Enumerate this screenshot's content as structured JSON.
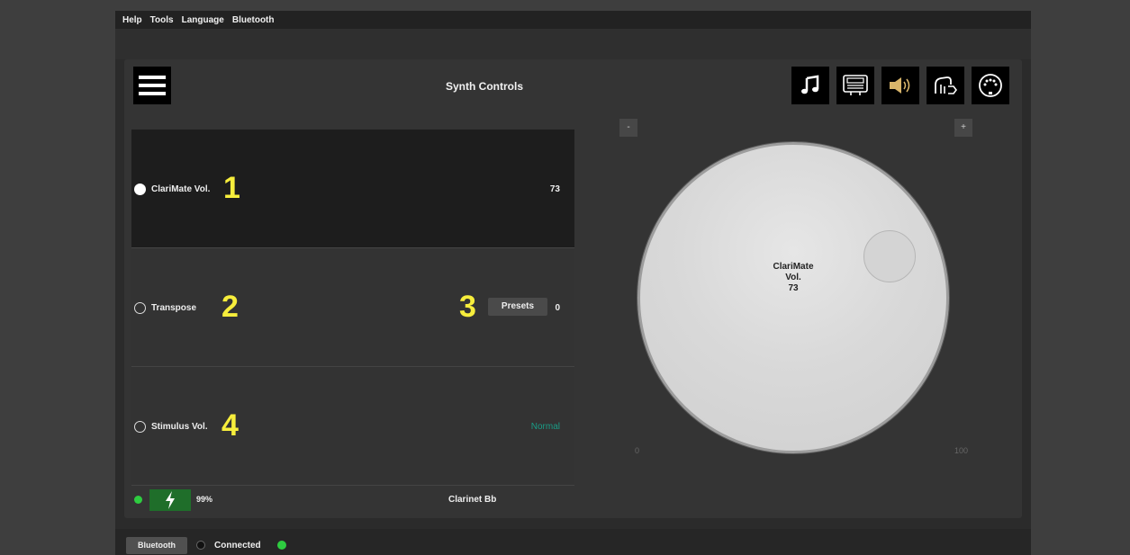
{
  "menu": [
    "Help",
    "Tools",
    "Language",
    "Bluetooth"
  ],
  "header": {
    "title": "Synth Controls"
  },
  "toolbar_icons": [
    "music-note-icon",
    "keyboard-icon",
    "speaker-icon",
    "hand-icon",
    "midi-connector-icon"
  ],
  "controls": [
    {
      "label": "ClariMate Vol.",
      "number": "1",
      "value": "73",
      "selected": true
    },
    {
      "label": "Transpose",
      "number": "2",
      "preset_number": "3",
      "preset_label": "Presets",
      "value": "0",
      "selected": false
    },
    {
      "label": "Stimulus Vol.",
      "number": "4",
      "value": "Normal",
      "selected": false
    }
  ],
  "status": {
    "battery_percent": "99%",
    "instrument": "Clarinet Bb"
  },
  "knob": {
    "minus_label": "-",
    "plus_label": "+",
    "min_label": "0",
    "max_label": "100",
    "line1": "ClariMate",
    "line2": "Vol.",
    "value": "73"
  },
  "footer": {
    "bluetooth_label": "Bluetooth",
    "connection_status": "Connected"
  },
  "colors": {
    "accent_yellow": "#f7ee3c",
    "status_green": "#2ecc40",
    "normal_teal": "#1a9c86"
  }
}
